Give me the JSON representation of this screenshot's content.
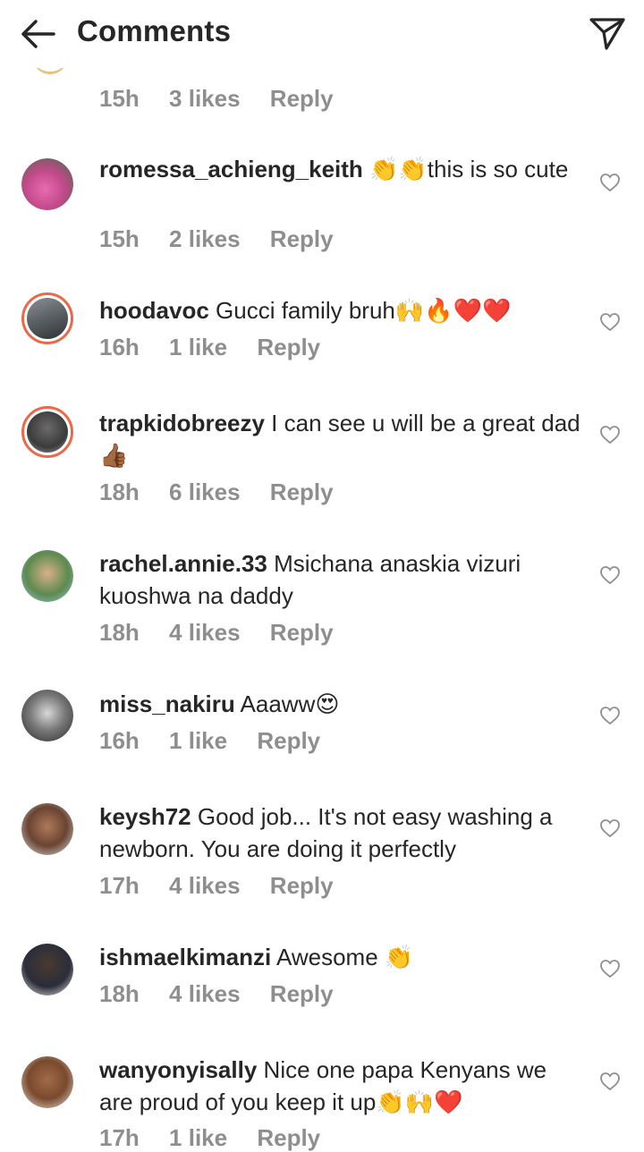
{
  "header": {
    "title": "Comments",
    "back_icon": "arrow-left-icon",
    "share_icon": "paper-plane-icon"
  },
  "partial_comment": {
    "time": "15h",
    "likes": "3 likes",
    "reply": "Reply"
  },
  "comments": [
    {
      "username": "romessa_achieng_keith",
      "text": " 👏👏this is so cute",
      "time": "15h",
      "likes": "2 likes",
      "reply": "Reply",
      "avatar_color": "#c24a8a"
    },
    {
      "username": "hoodavoc",
      "text": " Gucci family bruh🙌🔥❤️❤️",
      "time": "16h",
      "likes": "1 like",
      "reply": "Reply",
      "avatar_color": "#5a5f63"
    },
    {
      "username": "trapkidobreezy",
      "text": " I can see u will be a great dad 👍🏾",
      "time": "18h",
      "likes": "6 likes",
      "reply": "Reply",
      "avatar_color": "#3b3b3b"
    },
    {
      "username": "rachel.annie.33",
      "text": " Msichana anaskia vizuri kuoshwa na daddy",
      "time": "18h",
      "likes": "4 likes",
      "reply": "Reply",
      "avatar_color": "#5c8a4e"
    },
    {
      "username": "miss_nakiru",
      "text": " Aaaww😍",
      "time": "16h",
      "likes": "1 like",
      "reply": "Reply",
      "avatar_color": "#3a3a3a"
    },
    {
      "username": "keysh72",
      "text": " Good job... It's not easy washing a newborn. You are doing it perfectly",
      "time": "17h",
      "likes": "4 likes",
      "reply": "Reply",
      "avatar_color": "#6a4432"
    },
    {
      "username": "ishmaelkimanzi",
      "text": " Awesome 👏",
      "time": "18h",
      "likes": "4 likes",
      "reply": "Reply",
      "avatar_color": "#2a2d3a"
    },
    {
      "username": "wanyonyisally",
      "text": " Nice one papa Kenyans we are proud of you keep it up👏🙌❤️",
      "time": "17h",
      "likes": "1 like",
      "reply": "Reply",
      "avatar_color": "#7a4a2e"
    }
  ]
}
